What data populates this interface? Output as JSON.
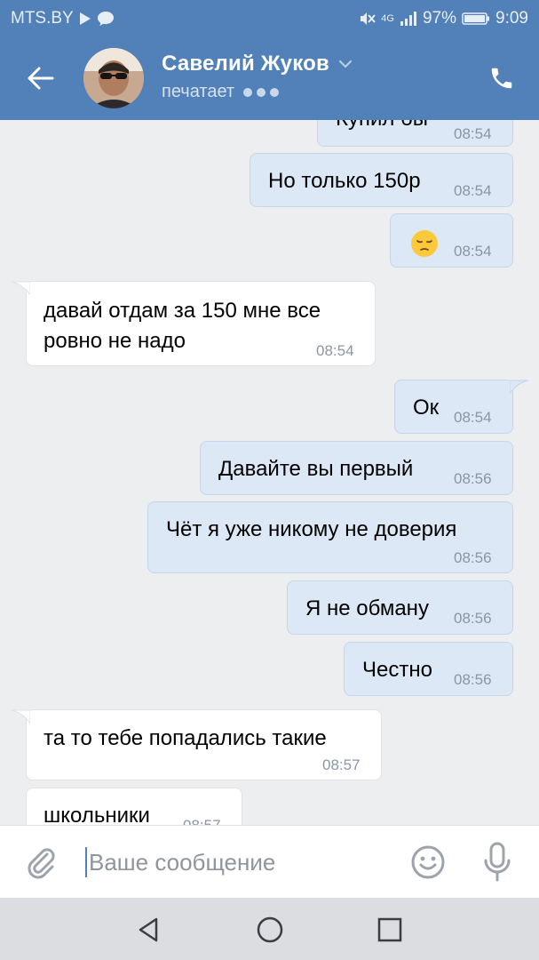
{
  "status_bar": {
    "carrier": "MTS.BY",
    "network": "4G",
    "battery": "97%",
    "time": "9:09"
  },
  "header": {
    "contact_name": "Савелий Жуков",
    "status": "печатает",
    "colors": {
      "bar": "#5181b8",
      "text": "#ffffff"
    }
  },
  "messages": [
    {
      "dir": "out",
      "text": "Купил бы",
      "time": "08:54"
    },
    {
      "dir": "out",
      "text": "Но только 150р",
      "time": "08:54"
    },
    {
      "dir": "out",
      "text": "😔",
      "time": "08:54",
      "emoji": "pensive-face-icon"
    },
    {
      "dir": "in",
      "text": "давай отдам за 150 мне все",
      "text2": "ровно не надо",
      "time": "08:54"
    },
    {
      "dir": "out",
      "text": "Ок",
      "time": "08:54"
    },
    {
      "dir": "out",
      "text": "Давайте вы первый",
      "time": "08:56"
    },
    {
      "dir": "out",
      "text": "Чёт я уже никому не доверия",
      "time": "08:56"
    },
    {
      "dir": "out",
      "text": "Я не обману",
      "time": "08:56"
    },
    {
      "dir": "out",
      "text": "Честно",
      "time": "08:56"
    },
    {
      "dir": "in",
      "text": "та то тебе попадались такие",
      "time": "08:57"
    },
    {
      "dir": "in",
      "text": "школьники",
      "time": "08:57"
    }
  ],
  "composer": {
    "placeholder": "Ваше сообщение"
  },
  "icons": {
    "back": "arrow-left-icon",
    "call": "phone-icon",
    "attach": "paperclip-icon",
    "emoji": "smile-icon",
    "mic": "microphone-icon",
    "nav_back": "triangle-back-icon",
    "nav_home": "circle-home-icon",
    "nav_recents": "square-recents-icon"
  }
}
